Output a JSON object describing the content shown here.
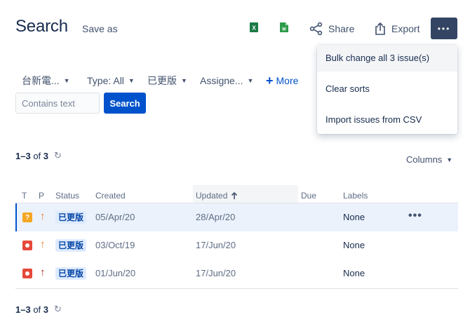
{
  "header": {
    "title": "Search",
    "save_as": "Save as",
    "excel_icon": "excel-icon",
    "word_icon": "word-icon",
    "share_label": "Share",
    "export_label": "Export",
    "more_label": "•••"
  },
  "menu": {
    "items": [
      {
        "label": "Bulk change all 3 issue(s)"
      },
      {
        "label": "Clear sorts"
      },
      {
        "label": "Import issues from CSV"
      }
    ]
  },
  "filters": [
    {
      "label": "台新電..."
    },
    {
      "label": "Type: All"
    },
    {
      "label": "已更版"
    },
    {
      "label": "Assigne..."
    }
  ],
  "more_filters": "More",
  "search": {
    "placeholder": "Contains text",
    "button": "Search"
  },
  "results": {
    "range": "1–3",
    "of": "of",
    "total": "3"
  },
  "columns_label": "Columns",
  "table": {
    "headers": {
      "t": "T",
      "p": "P",
      "status": "Status",
      "created": "Created",
      "updated": "Updated",
      "due": "Due",
      "labels": "Labels"
    },
    "rows": [
      {
        "type": "question",
        "priority": "medium",
        "status": "已更版",
        "created": "05/Apr/20",
        "updated": "28/Apr/20",
        "due": "",
        "labels": "None",
        "actions": "•••"
      },
      {
        "type": "bug",
        "priority": "medium",
        "status": "已更版",
        "created": "03/Oct/19",
        "updated": "17/Jun/20",
        "due": "",
        "labels": "None"
      },
      {
        "type": "bug",
        "priority": "high",
        "status": "已更版",
        "created": "01/Jun/20",
        "updated": "17/Jun/20",
        "due": "",
        "labels": "None"
      }
    ]
  },
  "colors": {
    "accent": "#0052cc",
    "status_bg": "#deebff",
    "status_text": "#0747a6",
    "priority_medium": "#e97f33",
    "priority_high": "#ae2a19",
    "bug": "#e5493a",
    "question": "#f5a623"
  }
}
